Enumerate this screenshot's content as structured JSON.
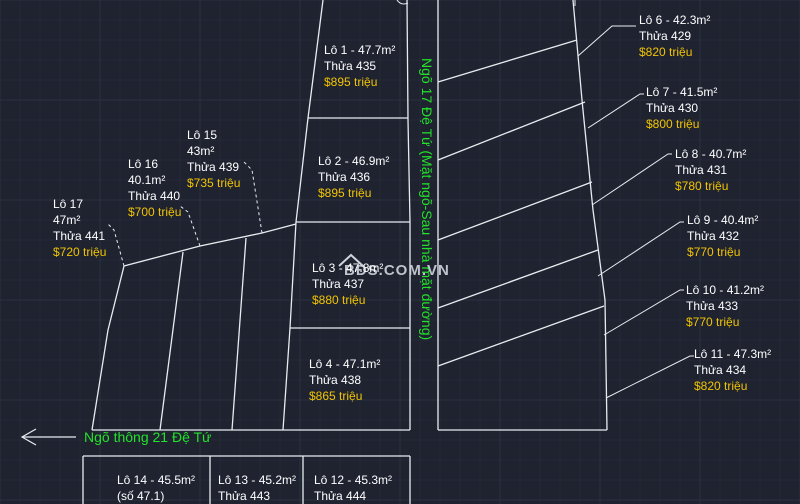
{
  "colors": {
    "background": "#1f2330",
    "grid": "#2b3140",
    "parcel_line": "#e8ecf0",
    "leader_line": "#e8ecf0",
    "label_text": "#ffffff",
    "price_text": "#f2c400",
    "road_text": "#22e22a",
    "watermark": "#cfd4dc"
  },
  "watermark": "BĐS.COM.VN",
  "watermark_icon": "house-roof-icon",
  "roads": {
    "vertical": "Ngõ 17 Đệ Tứ (Mặt ngõ-Sau nhà mặt đường)",
    "horizontal": "Ngõ thông 21 Đệ Tứ",
    "arrow_icon": "left-arrow-icon"
  },
  "lots": [
    {
      "id": "lot-1",
      "title": "Lô 1 - 47.7m²",
      "parcel": "Thửa 435",
      "price": "$895 triệu"
    },
    {
      "id": "lot-2",
      "title": "Lô 2 - 46.9m²",
      "parcel": "Thửa 436",
      "price": "$895 triệu"
    },
    {
      "id": "lot-3",
      "title": "Lô 3 - 47.8m²",
      "parcel": "Thửa 437",
      "price": "$880 triệu"
    },
    {
      "id": "lot-4",
      "title": "Lô 4 - 47.1m²",
      "parcel": "Thửa 438",
      "price": "$865 triệu"
    },
    {
      "id": "lot-6",
      "title": "Lô 6 - 42.3m²",
      "parcel": "Thửa 429",
      "price": "$820 triệu"
    },
    {
      "id": "lot-7",
      "title": "Lô 7 - 41.5m²",
      "parcel": "Thửa 430",
      "price": "$800 triệu"
    },
    {
      "id": "lot-8",
      "title": "Lô 8 - 40.7m²",
      "parcel": "Thửa 431",
      "price": "$780 triệu"
    },
    {
      "id": "lot-9",
      "title": "Lô 9 - 40.4m²",
      "parcel": "Thửa 432",
      "price": "$770 triệu"
    },
    {
      "id": "lot-10",
      "title": "Lô 10 - 41.2m²",
      "parcel": "Thửa 433",
      "price": "$770 triệu"
    },
    {
      "id": "lot-11",
      "title": "Lô 11 - 47.3m²",
      "parcel": "Thửa 434",
      "price": "$820 triệu"
    },
    {
      "id": "lot-12",
      "title": "Lô 12 - 45.3m²",
      "parcel": "Thửa 444",
      "price": ""
    },
    {
      "id": "lot-13",
      "title": "Lô 13 - 45.2m²",
      "parcel": "Thửa 443",
      "price": ""
    },
    {
      "id": "lot-14",
      "title": "Lô 14 - 45.5m²",
      "parcel": "(số 47.1)",
      "price": ""
    },
    {
      "id": "lot-15",
      "lot": "Lô 15",
      "area": "43m²",
      "parcel": "Thửa 439",
      "price": "$735 triệu"
    },
    {
      "id": "lot-16",
      "lot": "Lô 16",
      "area": "40.1m²",
      "parcel": "Thửa 440",
      "price": "$700 triệu"
    },
    {
      "id": "lot-17",
      "lot": "Lô 17",
      "area": "47m²",
      "parcel": "Thửa 441",
      "price": "$720 triệu"
    }
  ]
}
